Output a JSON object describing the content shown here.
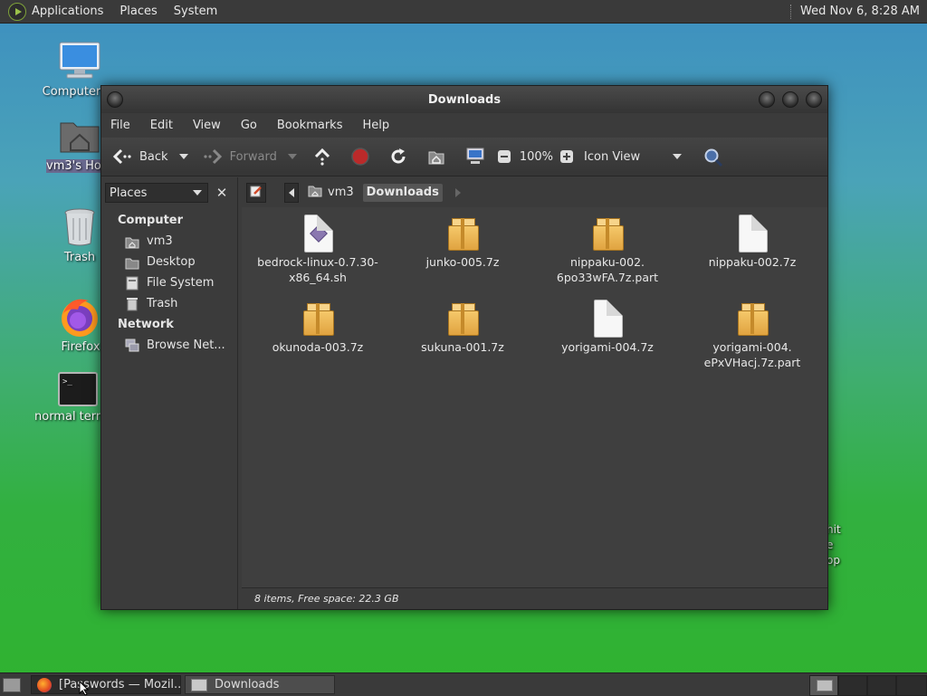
{
  "top_panel": {
    "menus": [
      "Applications",
      "Places",
      "System"
    ],
    "clock": "Wed Nov  6,  8:28 AM"
  },
  "desktop_icons": [
    {
      "label": "Computer",
      "icon": "computer-icon"
    },
    {
      "label": "vm3's Home",
      "icon": "home-folder-icon"
    },
    {
      "label": "Trash",
      "icon": "trash-icon"
    },
    {
      "label": "Firefox",
      "icon": "firefox-icon"
    },
    {
      "label": "normal terminal",
      "icon": "terminal-icon"
    }
  ],
  "behind_text": [
    "hit",
    "e",
    "op"
  ],
  "window": {
    "title": "Downloads",
    "menu": [
      "File",
      "Edit",
      "View",
      "Go",
      "Bookmarks",
      "Help"
    ],
    "toolbar": {
      "back": "Back",
      "forward": "Forward",
      "zoom": "100%",
      "view_mode": "Icon View"
    },
    "sidebar": {
      "selector": "Places",
      "sections": [
        {
          "heading": "Computer",
          "items": [
            {
              "label": "vm3",
              "icon": "home-icon"
            },
            {
              "label": "Desktop",
              "icon": "desktop-icon"
            },
            {
              "label": "File System",
              "icon": "drive-icon"
            },
            {
              "label": "Trash",
              "icon": "trash-icon"
            }
          ]
        },
        {
          "heading": "Network",
          "items": [
            {
              "label": "Browse Net...",
              "icon": "network-icon"
            }
          ]
        }
      ]
    },
    "path": [
      "vm3",
      "Downloads"
    ],
    "files": [
      {
        "name": "bedrock-linux-0.7.30-x86_64.sh",
        "line1": "bedrock-linux-0.7.30-",
        "line2": "x86_64.sh",
        "icon": "script-file-icon"
      },
      {
        "name": "junko-005.7z",
        "line1": "junko-005.7z",
        "line2": "",
        "icon": "archive-icon"
      },
      {
        "name": "nippaku-002.6po33wFA.7z.part",
        "line1": "nippaku-002.",
        "line2": "6po33wFA.7z.part",
        "icon": "archive-icon"
      },
      {
        "name": "nippaku-002.7z",
        "line1": "nippaku-002.7z",
        "line2": "",
        "icon": "blank-file-icon"
      },
      {
        "name": "okunoda-003.7z",
        "line1": "okunoda-003.7z",
        "line2": "",
        "icon": "archive-icon"
      },
      {
        "name": "sukuna-001.7z",
        "line1": "sukuna-001.7z",
        "line2": "",
        "icon": "archive-icon"
      },
      {
        "name": "yorigami-004.7z",
        "line1": "yorigami-004.7z",
        "line2": "",
        "icon": "blank-file-icon"
      },
      {
        "name": "yorigami-004.ePxVHacj.7z.part",
        "line1": "yorigami-004.",
        "line2": "ePxVHacj.7z.part",
        "icon": "archive-icon"
      }
    ],
    "status": "8 items, Free space: 22.3 GB"
  },
  "taskbar": [
    {
      "label": "[Passwords — Mozil...",
      "icon": "firefox-icon"
    },
    {
      "label": "Downloads",
      "icon": "folder-icon"
    }
  ]
}
